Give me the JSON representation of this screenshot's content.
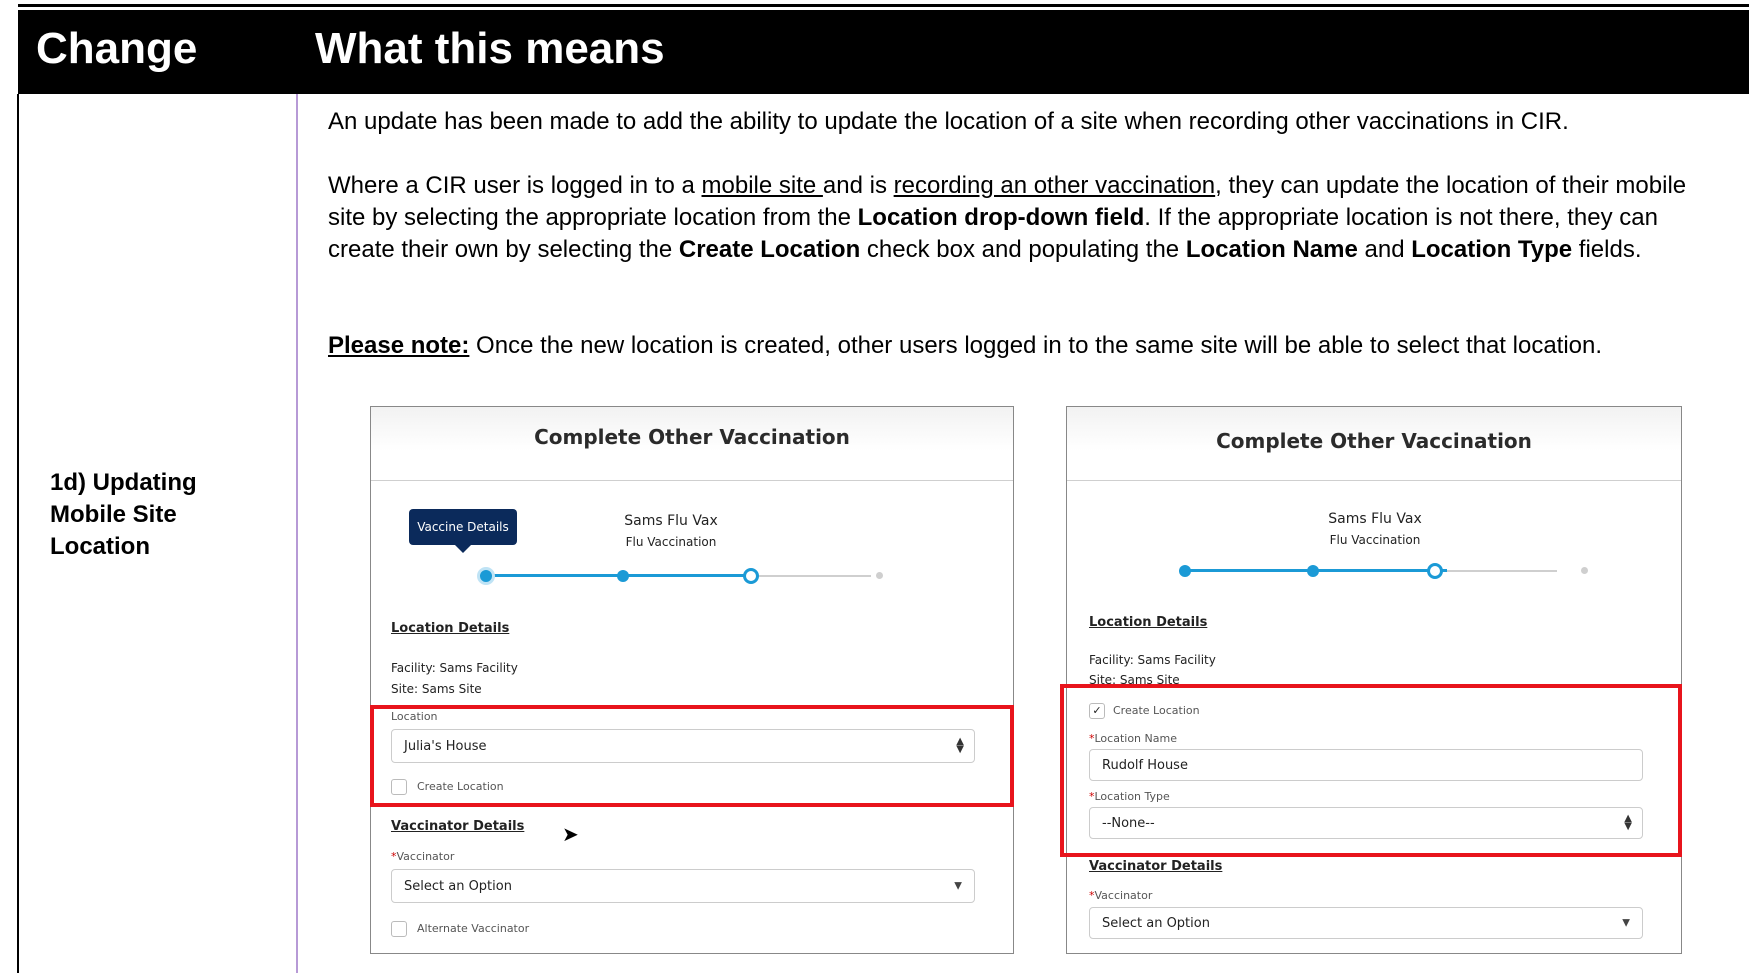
{
  "header": {
    "change": "Change",
    "what_this_means": "What this means"
  },
  "change_label": "1d) Updating Mobile Site Location",
  "description": {
    "p1": "An update has been made to add the ability to update the location of a site when recording other vaccinations in CIR.",
    "p2_a": "Where a CIR user is logged in to a ",
    "p2_mobile_site": "mobile site ",
    "p2_b": "and is ",
    "p2_recording": "recording an other vaccination",
    "p2_c": ", they can update the location of their mobile site by selecting the appropriate location from the ",
    "p2_location_dropdown": "Location drop-down field",
    "p2_d": ". If the appropriate location is not there, they can create their own by selecting the ",
    "p2_create_location": "Create Location",
    "p2_e": " check box and populating the ",
    "p2_location_name": "Location Name",
    "p2_f": " and ",
    "p2_location_type": "Location Type",
    "p2_g": " fields.",
    "note_label": "Please note:",
    "note_text": " Once the new location is created, other users logged in to the same site will be able to select that location."
  },
  "left_panel": {
    "title": "Complete Other Vaccination",
    "tooltip": "Vaccine Details",
    "vaccine_name": "Sams Flu Vax",
    "vaccine_type": "Flu Vaccination",
    "location_details": "Location Details",
    "facility": "Facility: Sams Facility",
    "site": "Site: Sams Site",
    "location_label": "Location",
    "location_value": "Julia's House",
    "create_location": "Create Location",
    "vaccinator_details": "Vaccinator Details",
    "vaccinator_label": "Vaccinator",
    "vaccinator_placeholder": "Select an Option",
    "alternate_vaccinator": "Alternate Vaccinator"
  },
  "right_panel": {
    "title": "Complete Other Vaccination",
    "vaccine_name": "Sams Flu Vax",
    "vaccine_type": "Flu Vaccination",
    "location_details": "Location Details",
    "facility": "Facility: Sams Facility",
    "site": "Site: Sams Site",
    "create_location": "Create Location",
    "location_name_label": "Location Name",
    "location_name_value": "Rudolf House",
    "location_type_label": "Location Type",
    "location_type_value": "--None--",
    "vaccinator_details": "Vaccinator Details",
    "vaccinator_label": "Vaccinator",
    "vaccinator_placeholder": "Select an Option"
  },
  "colors": {
    "header_bg": "#000000",
    "divider": "#b79ad6",
    "highlight": "#e8141c",
    "progress": "#1b9ad6",
    "tooltip_bg": "#0b2a5b"
  }
}
